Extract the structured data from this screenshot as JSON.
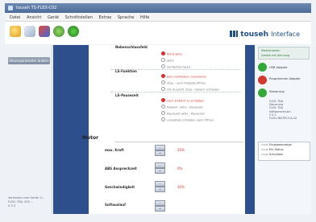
{
  "window": {
    "title": "touseh TS-FLEX-C02"
  },
  "menu": [
    "Datei",
    "Ansicht",
    "Gerät",
    "Schnittstellen",
    "Extras",
    "Sprache",
    "Hilfe"
  ],
  "brand": {
    "name": "touseh",
    "suffix": "Interface"
  },
  "nav": {
    "active_item": "Steuerparameter ändern"
  },
  "status_lines": [
    "Verbinden zum Gerät: 0...",
    "FLEX: TDA, 003 ...",
    "V 5.3"
  ],
  "settings": {
    "rows": [
      {
        "label": "Nebenschlussfeld",
        "options": [
          {
            "text": "Nicht aktiv",
            "on": true
          },
          {
            "text": "aktiv",
            "on": false
          },
          {
            "text": "Sonderlösung Ex",
            "on": false
          }
        ]
      },
      {
        "label": "LS-Funktion",
        "options": [
          {
            "text": "beim Schließen: reversieren",
            "on": true
          },
          {
            "text": "Stop - nach Freigabe öffnen",
            "on": false
          },
          {
            "text": "mit Zusatzfl. Stop - danach schließen",
            "on": false
          }
        ]
      },
      {
        "label": "LS-Pausezeit",
        "options": [
          {
            "text": "nach Einfahrt zu schließen",
            "on": true
          },
          {
            "text": "Nebenlt. aktiv - Pausezeit",
            "on": false
          },
          {
            "text": "Pausezeit aktiv - Pausezeit",
            "on": false
          },
          {
            "text": "unbedingt schließen nach Öffnen",
            "on": false
          }
        ]
      }
    ]
  },
  "motor": {
    "title": "Motor",
    "params": [
      {
        "label": "max. Kraft",
        "value": "20%"
      },
      {
        "label": "ABS Ansprechzeit",
        "value": "0%"
      },
      {
        "label": "Geschwindigkeit",
        "value": "30%"
      },
      {
        "label": "Softauslauf",
        "value": ""
      }
    ],
    "button_minus": "-",
    "button_plus": "+"
  },
  "right_panel": {
    "header": [
      "Modellnamen",
      "Geräte mit Kennung"
    ],
    "items": [
      {
        "text": "USB Adapter",
        "color": "#35a83a"
      },
      {
        "text": "Programmier Adapter",
        "color": "#d23a2e"
      },
      {
        "text": "Steuerung",
        "color": "#35a83a"
      }
    ],
    "device_lines": [
      "FLEX: TDA",
      "Steuerung",
      "FLEX: TDA",
      "Softwareversion",
      "V 5.3",
      "FLEX-ONSTIR-FLA-10"
    ],
    "log": [
      "==> Eingabeanzeige",
      "==> Ein-Status",
      "==> Schreiben"
    ]
  },
  "colors": {
    "band": "#2d4f8c",
    "accent_red": "#d33",
    "ok_green": "#35a83a"
  }
}
